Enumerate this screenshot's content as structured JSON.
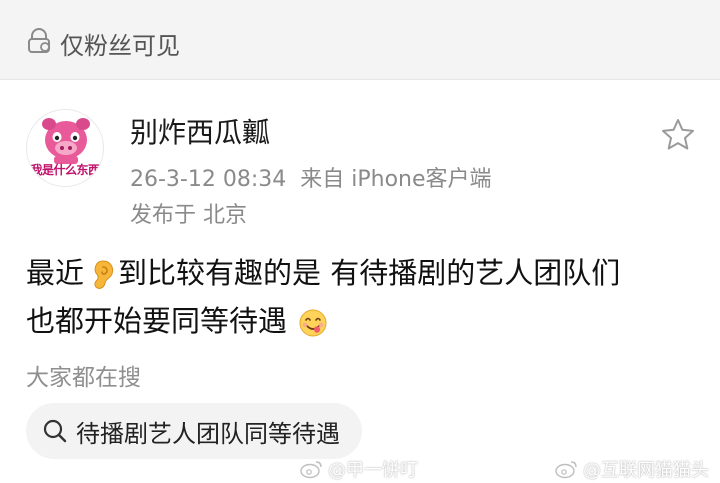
{
  "visibility": {
    "icon": "lock-person-icon",
    "label": "仅粉丝可见"
  },
  "post": {
    "avatar_caption": "我是什么东西",
    "username": "别炸西瓜瓤",
    "timestamp": "26-3-12 08:34",
    "source": "来自 iPhone客户端",
    "location": "发布于 北京",
    "content": {
      "line1_before": "最近",
      "line1_after": "到比较有趣的是 有待播剧的艺人团队们",
      "line2": "也都开始要同等待遇",
      "emoji1": "ear-emoji",
      "emoji2": "yum-face-emoji"
    },
    "favorite_icon": "star-outline-icon"
  },
  "hot_search": {
    "label": "大家都在搜",
    "query": "待播剧艺人团队同等待遇",
    "icon": "search-icon"
  },
  "watermarks": [
    "@甲一饼叮",
    "@互联网猫猫头"
  ],
  "colors": {
    "visibility_bg": "#f4f4f4",
    "meta_text": "#8a8a8a",
    "chip_bg": "#f3f3f3",
    "avatar_accent": "#c0136b"
  }
}
